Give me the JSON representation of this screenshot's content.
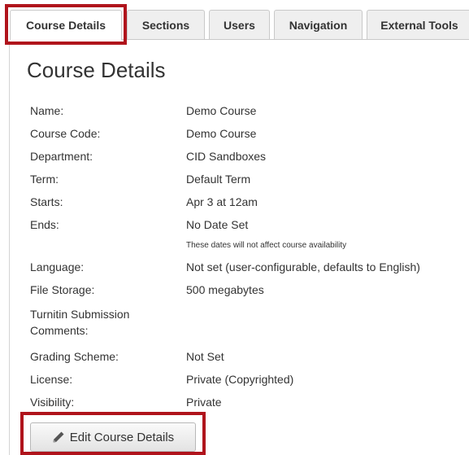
{
  "tabs": [
    {
      "label": "Course Details",
      "active": true
    },
    {
      "label": "Sections"
    },
    {
      "label": "Users"
    },
    {
      "label": "Navigation"
    },
    {
      "label": "External Tools"
    }
  ],
  "page_title": "Course Details",
  "details": [
    {
      "label": "Name:",
      "value": "Demo Course"
    },
    {
      "label": "Course Code:",
      "value": "Demo Course"
    },
    {
      "label": "Department:",
      "value": "CID Sandboxes"
    },
    {
      "label": "Term:",
      "value": "Default Term"
    },
    {
      "label": "Starts:",
      "value": "Apr 3 at 12am"
    },
    {
      "label": "Ends:",
      "value": "No Date Set"
    },
    {
      "label": "Language:",
      "value": "Not set (user-configurable, defaults to English)"
    },
    {
      "label": "File Storage:",
      "value": "500 megabytes"
    },
    {
      "label": "Turnitin Submission Comments:",
      "value": ""
    },
    {
      "label": "Grading Scheme:",
      "value": "Not Set"
    },
    {
      "label": "License:",
      "value": "Private (Copyrighted)"
    },
    {
      "label": "Visibility:",
      "value": "Private"
    }
  ],
  "dates_note": "These dates will not affect course availability",
  "edit_button_label": "Edit Course Details",
  "icons": {
    "edit": "pencil-icon"
  },
  "colors": {
    "highlight": "#b0141c"
  }
}
